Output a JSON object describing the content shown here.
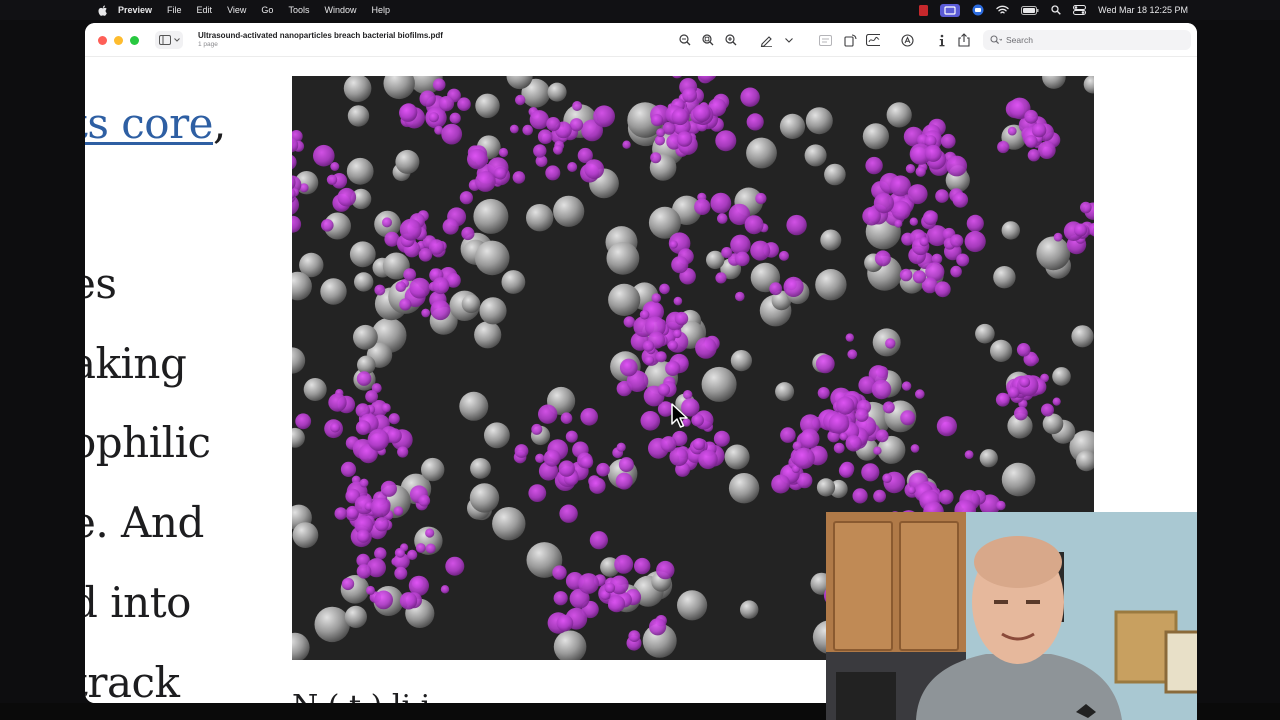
{
  "menubar": {
    "app_name": "Preview",
    "menus": [
      "File",
      "Edit",
      "View",
      "Go",
      "Tools",
      "Window",
      "Help"
    ],
    "clock": "Wed Mar 18  12:25 PM"
  },
  "window": {
    "title": "Ultrasound-activated nanoparticles breach bacterial biofilms.pdf",
    "subtitle": "1 page",
    "search_placeholder": "Search"
  },
  "document": {
    "line1_link": "ts core",
    "line1_tail": ",",
    "lines": [
      "es",
      "aking",
      "ophilic",
      "e. And",
      "d into",
      "track"
    ],
    "caption_partial": "N                   (         t )   li i"
  },
  "colors": {
    "accent_link": "#2e5fa3",
    "micrograph_magenta": "#b03cc8",
    "micrograph_gray": "#9a9a9a"
  },
  "icons": {
    "apple": "apple-icon",
    "zoom_out": "zoom-out-icon",
    "zoom_fit": "zoom-fit-icon",
    "zoom_in": "zoom-in-icon",
    "markup": "markup-pen-icon",
    "search": "search-icon"
  }
}
